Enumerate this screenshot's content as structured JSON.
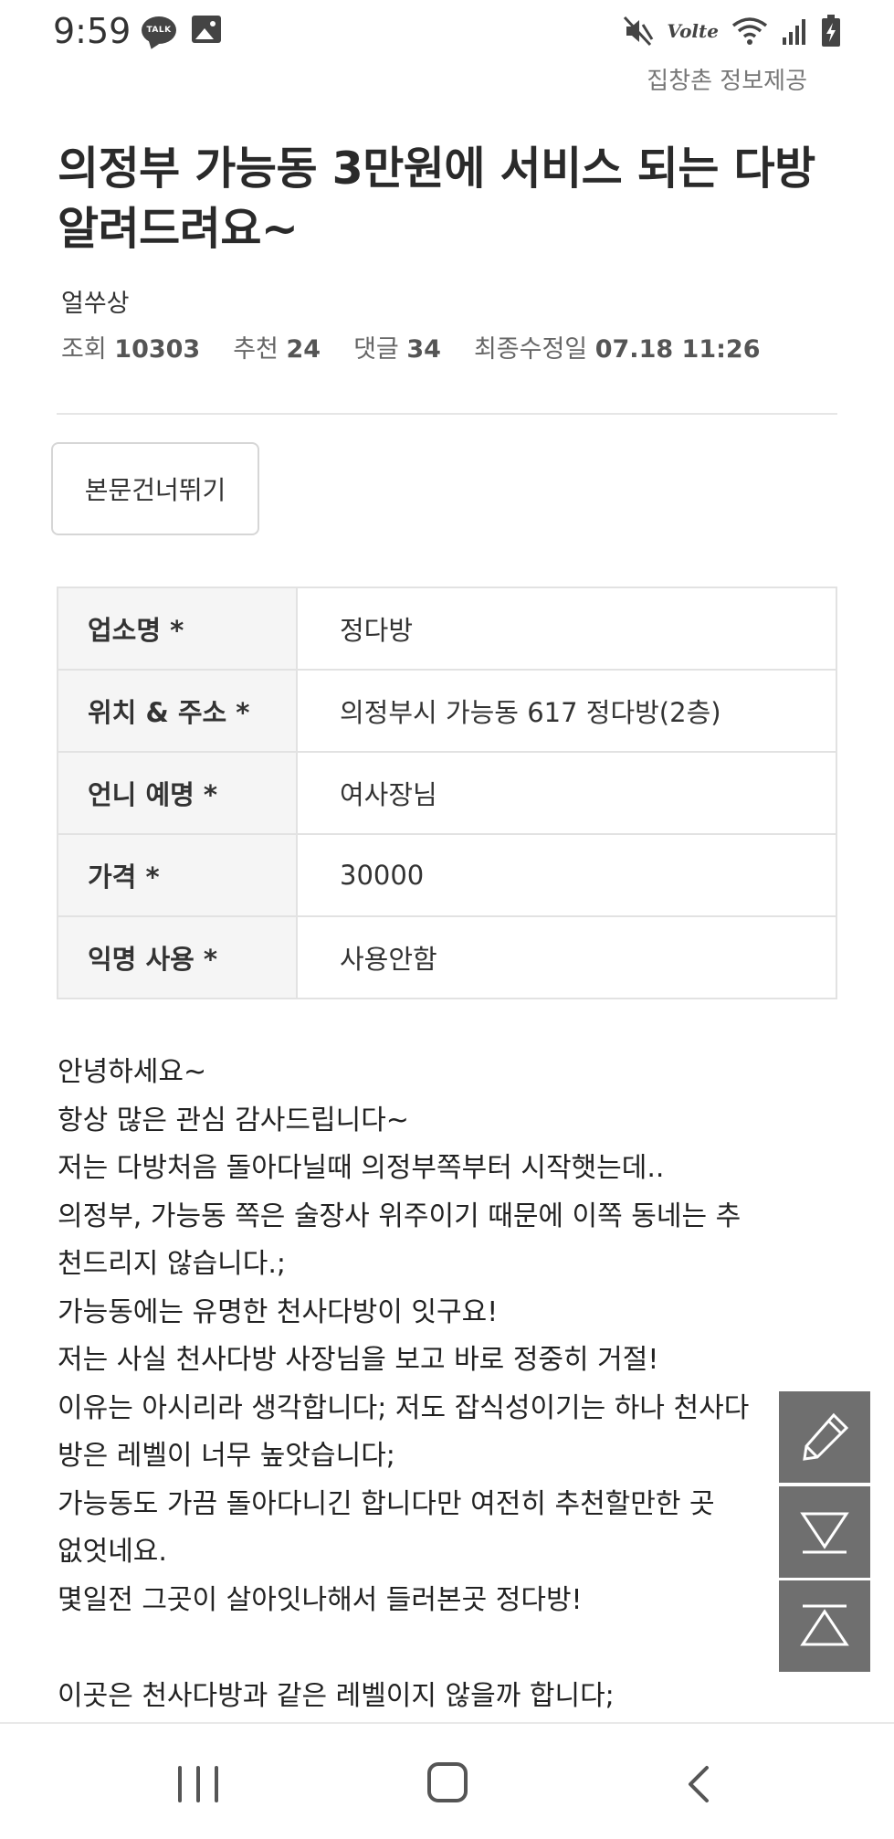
{
  "status_bar": {
    "time": "9:59",
    "talk_badge": "TALK",
    "volte_label": "Volte",
    "icons": [
      "talk-icon",
      "gallery-icon",
      "mute-icon",
      "wifi-icon",
      "signal-icon",
      "battery-icon"
    ]
  },
  "provider": "집창촌 정보제공",
  "post": {
    "title": "의정부 가능동 3만원에 서비스 되는 다방 알려드려요~",
    "author": "얼쑤상",
    "meta": {
      "views_label": "조회",
      "views": "10303",
      "recommend_label": "추천",
      "recommend": "24",
      "comments_label": "댓글",
      "comments": "34",
      "modified_label": "최종수정일",
      "modified": "07.18 11:26"
    },
    "skip_button": "본문건너뛰기",
    "info_table": [
      {
        "label": "업소명 *",
        "value": "정다방"
      },
      {
        "label": "위치 & 주소 *",
        "value": "의정부시 가능동 617 정다방(2층)"
      },
      {
        "label": "언니 예명 *",
        "value": "여사장님"
      },
      {
        "label": "가격 *",
        "value": "30000"
      },
      {
        "label": "익명 사용 *",
        "value": "사용안함"
      }
    ],
    "body_lines": [
      "안녕하세요~",
      "항상 많은 관심 감사드립니다~",
      "저는 다방처음 돌아다닐때 의정부쪽부터 시작햇는데..",
      "의정부, 가능동 쪽은 술장사 위주이기 때문에 이쪽 동네는 추",
      "천드리지 않습니다.;",
      "가능동에는 유명한 천사다방이 잇구요!",
      "저는 사실 천사다방 사장님을 보고 바로 정중히 거절!",
      "이유는 아시리라 생각합니다; 저도 잡식성이기는 하나 천사다",
      "방은 레벨이 너무 높앗습니다;",
      "가능동도 가끔 돌아다니긴 합니다만 여전히 추천할만한 곳",
      "없엇네요.",
      "몇일전 그곳이 살아잇나해서 들러본곳 정다방!",
      "",
      "이곳은 천사다방과 같은 레벨이지 않을까 합니다;"
    ]
  },
  "floating_buttons": [
    "write-pencil-icon",
    "scroll-bottom-icon",
    "scroll-top-icon"
  ],
  "nav_bar": [
    "recent-apps-icon",
    "home-icon",
    "back-icon"
  ]
}
